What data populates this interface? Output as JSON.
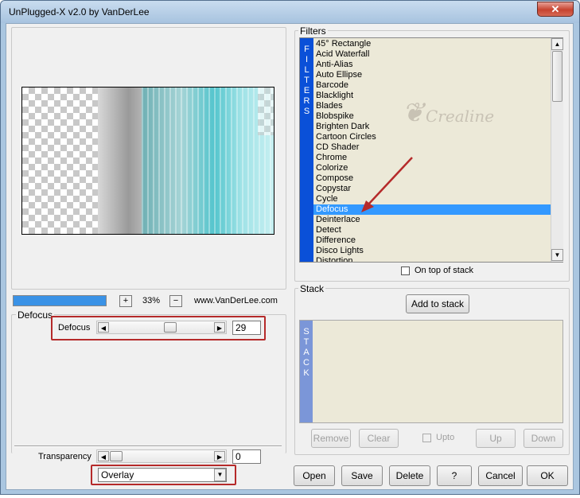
{
  "window": {
    "title": "UnPlugged-X v2.0 by VanDerLee",
    "close_glyph": "✕"
  },
  "preview": {
    "zoom": "33%",
    "zoom_in": "+",
    "zoom_out": "−",
    "website": "www.VanDerLee.com"
  },
  "defocus_group": {
    "title": "Defocus",
    "param_label": "Defocus",
    "param_value": "29",
    "param_level_percent": 60
  },
  "transparency": {
    "label": "Transparency",
    "value": "0",
    "level_percent": 0
  },
  "blend_mode": {
    "selected": "Overlay"
  },
  "filters": {
    "title": "Filters",
    "side_label": [
      "F",
      "I",
      "L",
      "T",
      "E",
      "R",
      "S"
    ],
    "items": [
      "45° Rectangle",
      "Acid Waterfall",
      "Anti-Alias",
      "Auto Ellipse",
      "Barcode",
      "Blacklight",
      "Blades",
      "Blobspike",
      "Brighten Dark",
      "Cartoon Circles",
      "CD Shader",
      "Chrome",
      "Colorize",
      "Compose",
      "Copystar",
      "Cycle",
      "Defocus",
      "Deinterlace",
      "Detect",
      "Difference",
      "Disco Lights",
      "Distortion"
    ],
    "selected": "Defocus",
    "on_top_label": "On top of stack",
    "watermark": "Crealine"
  },
  "stack": {
    "title": "Stack",
    "add_label": "Add to stack",
    "side_label": [
      "S",
      "T",
      "A",
      "C",
      "K"
    ],
    "remove_label": "Remove",
    "clear_label": "Clear",
    "upto_label": "Upto",
    "up_label": "Up",
    "down_label": "Down"
  },
  "bottom_buttons": {
    "open": "Open",
    "save": "Save",
    "delete": "Delete",
    "help": "?",
    "cancel": "Cancel",
    "ok": "OK"
  },
  "colors": {
    "selection": "#3399ff",
    "filter_side": "#0a50d8",
    "stack_side": "#7b96d8",
    "highlight": "#b52a2a",
    "progress": "#3a92e6"
  }
}
